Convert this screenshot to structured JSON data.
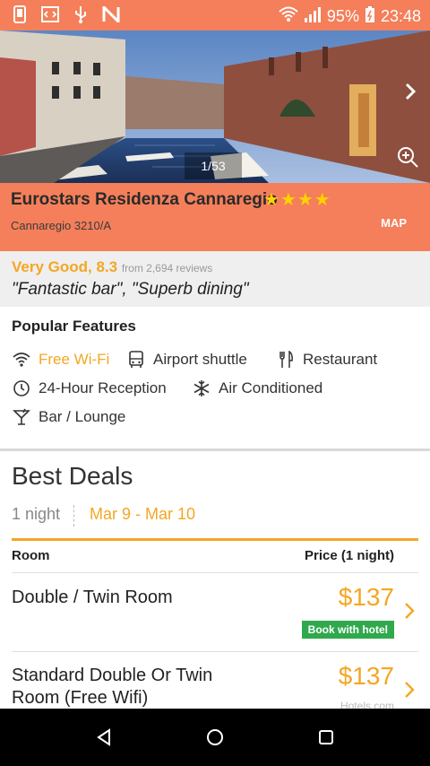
{
  "status_bar": {
    "battery": "95%",
    "time": "23:48",
    "left_icons": [
      "phone-icon",
      "code-icon",
      "usb-icon",
      "n-icon"
    ],
    "right_icons": [
      "wifi-icon",
      "signal-icon",
      "battery-charging-icon"
    ]
  },
  "hero": {
    "counter": "1/53",
    "next_icon": "chevron-right-icon",
    "zoom_icon": "zoom-in-icon"
  },
  "hotel": {
    "name": "Eurostars Residenza Cannaregio",
    "stars": "★★★★",
    "address": "Cannaregio 3210/A",
    "map_label": "MAP"
  },
  "rating": {
    "label": "Very Good, 8.3",
    "reviews": "from 2,694 reviews",
    "quote": "\"Fantastic bar\", \"Superb dining\""
  },
  "features": {
    "title": "Popular Features",
    "items": [
      {
        "label": "Free Wi-Fi",
        "icon": "wifi-icon",
        "highlight": true
      },
      {
        "label": "Airport shuttle",
        "icon": "bus-icon"
      },
      {
        "label": "Restaurant",
        "icon": "cutlery-icon"
      },
      {
        "label": "24-Hour Reception",
        "icon": "clock-icon"
      },
      {
        "label": "Air Conditioned",
        "icon": "snowflake-icon"
      },
      {
        "label": "Bar / Lounge",
        "icon": "cocktail-icon"
      }
    ]
  },
  "deals": {
    "title": "Best Deals",
    "nights": "1 night",
    "dates": "Mar 9 - Mar 10",
    "col_room": "Room",
    "col_price": "Price (1 night)",
    "rows": [
      {
        "room": "Double / Twin Room",
        "price": "$137",
        "badge": "Book with hotel"
      },
      {
        "room": "Standard Double Or Twin Room (Free Wifi)",
        "price": "$137",
        "provider": "Hotels.com"
      }
    ]
  },
  "navbar": {
    "icons": [
      "back-icon",
      "home-icon",
      "recents-icon"
    ]
  },
  "colors": {
    "accent": "#f47f5a",
    "orange": "#f5a623",
    "green": "#2fa94c"
  }
}
